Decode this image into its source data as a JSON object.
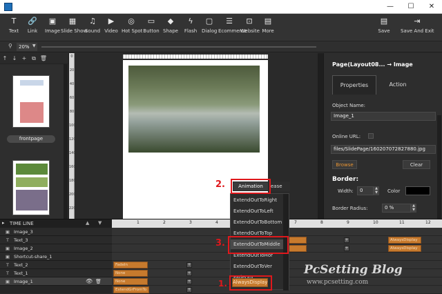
{
  "window": {
    "minimize": "—",
    "maximize": "☐",
    "close": "✕"
  },
  "toolbar": {
    "tools": [
      {
        "label": "Text",
        "icon": "T"
      },
      {
        "label": "Link",
        "icon": "🔗"
      },
      {
        "label": "Image",
        "icon": "▣"
      },
      {
        "label": "Slide Show",
        "icon": "▦"
      },
      {
        "label": "Sound",
        "icon": "♫"
      },
      {
        "label": "Video",
        "icon": "▶"
      },
      {
        "label": "Hot Spot",
        "icon": "◎"
      },
      {
        "label": "Button",
        "icon": "▭"
      },
      {
        "label": "Shape",
        "icon": "◆"
      },
      {
        "label": "Flash",
        "icon": "ϟ"
      },
      {
        "label": "Dialog",
        "icon": "▢"
      },
      {
        "label": "Ecommerce",
        "icon": "☰"
      },
      {
        "label": "Website",
        "icon": "⊡"
      },
      {
        "label": "More",
        "icon": "▤"
      }
    ],
    "save_label": "Save",
    "save_exit_label": "Save And Exit"
  },
  "zoom": {
    "value": "20%"
  },
  "left_panel": {
    "page_name": "frontpage"
  },
  "ruler_v": [
    "0",
    "20",
    "40",
    "60",
    "80",
    "100",
    "120",
    "140",
    "160",
    "180",
    "200",
    "220"
  ],
  "right_panel": {
    "title": "Page(Layout08... → Image",
    "tabs": [
      "Properties",
      "Action"
    ],
    "object_name_label": "Object Name:",
    "object_name_value": "Image_1",
    "online_url_label": "Online URL:",
    "file_path": "files/SlidePage/160207072827880.jpg",
    "browse_label": "Browse",
    "clear_label": "Clear",
    "border_heading": "Border:",
    "width_label": "Width:",
    "width_value": "0",
    "color_label": "Color",
    "border_radius_label": "Border Radius:",
    "border_radius_value": "0 %"
  },
  "timeline": {
    "title": "TIME LINE",
    "scale": [
      "1",
      "2",
      "3",
      "4",
      "5",
      "6",
      "7",
      "8",
      "9",
      "10",
      "11",
      "12"
    ],
    "layers": [
      {
        "name": "Image_3",
        "icon": "▣"
      },
      {
        "name": "Text_3",
        "icon": "T"
      },
      {
        "name": "Image_2",
        "icon": "▣"
      },
      {
        "name": "Shortcut-share_1",
        "icon": "▣"
      },
      {
        "name": "Text_2",
        "icon": "T"
      },
      {
        "name": "Text_1",
        "icon": "T"
      },
      {
        "name": "Image_1",
        "icon": "▣"
      }
    ],
    "block_fadein": "FadeIn",
    "block_none": "None",
    "block_extend": "ExtendGrFromTo",
    "block_always": "AlwaysDisplay"
  },
  "animation": {
    "button_label": "Animation",
    "ease_label": "ease",
    "options": [
      "ExtendOutToRight",
      "ExtendOutToLeft",
      "ExtendOutToBottom",
      "ExtendOutToTop",
      "ExtendOutToMiddle",
      "ExtendOutToHor",
      "ExtendOutToVer",
      "FadeOut"
    ],
    "selected": "AlwaysDisplay"
  },
  "steps": [
    "1.",
    "2.",
    "3."
  ],
  "watermark": {
    "main": "PcSetting Blog",
    "url": "www.pcsetting.com"
  }
}
